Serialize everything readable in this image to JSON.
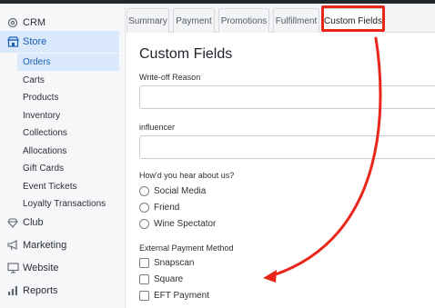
{
  "sidebar": {
    "items": [
      {
        "label": "CRM",
        "icon": "gear-icon"
      },
      {
        "label": "Store",
        "icon": "store-icon"
      },
      {
        "label": "Club",
        "icon": "diamond-icon"
      },
      {
        "label": "Marketing",
        "icon": "megaphone-icon"
      },
      {
        "label": "Website",
        "icon": "monitor-icon"
      },
      {
        "label": "Reports",
        "icon": "bar-chart-icon"
      }
    ],
    "store_subitems": [
      {
        "label": "Orders"
      },
      {
        "label": "Carts"
      },
      {
        "label": "Products"
      },
      {
        "label": "Inventory"
      },
      {
        "label": "Collections"
      },
      {
        "label": "Allocations"
      },
      {
        "label": "Gift Cards"
      },
      {
        "label": "Event Tickets"
      },
      {
        "label": "Loyalty Transactions"
      }
    ],
    "active_item": "Store",
    "active_subitem": "Orders"
  },
  "tabs": [
    {
      "label": "Summary"
    },
    {
      "label": "Payment"
    },
    {
      "label": "Promotions"
    },
    {
      "label": "Fulfillment"
    },
    {
      "label": "Custom Fields"
    }
  ],
  "active_tab": "Custom Fields",
  "main": {
    "title": "Custom Fields",
    "writeoff": {
      "label": "Write-off Reason",
      "value": ""
    },
    "influencer": {
      "label": "influencer",
      "value": ""
    },
    "hear": {
      "label": "How'd you hear about us?",
      "options": [
        {
          "label": "Social Media"
        },
        {
          "label": "Friend"
        },
        {
          "label": "Wine Spectator"
        }
      ]
    },
    "payment": {
      "label": "External Payment Method",
      "options": [
        {
          "label": "Snapscan"
        },
        {
          "label": "Square"
        },
        {
          "label": "EFT Payment"
        }
      ]
    }
  },
  "colors": {
    "annotation": "#e8261a",
    "active_nav_bg": "#d9e9fb",
    "active_nav_text": "#1a5fb4",
    "topbar": "#23262b"
  }
}
